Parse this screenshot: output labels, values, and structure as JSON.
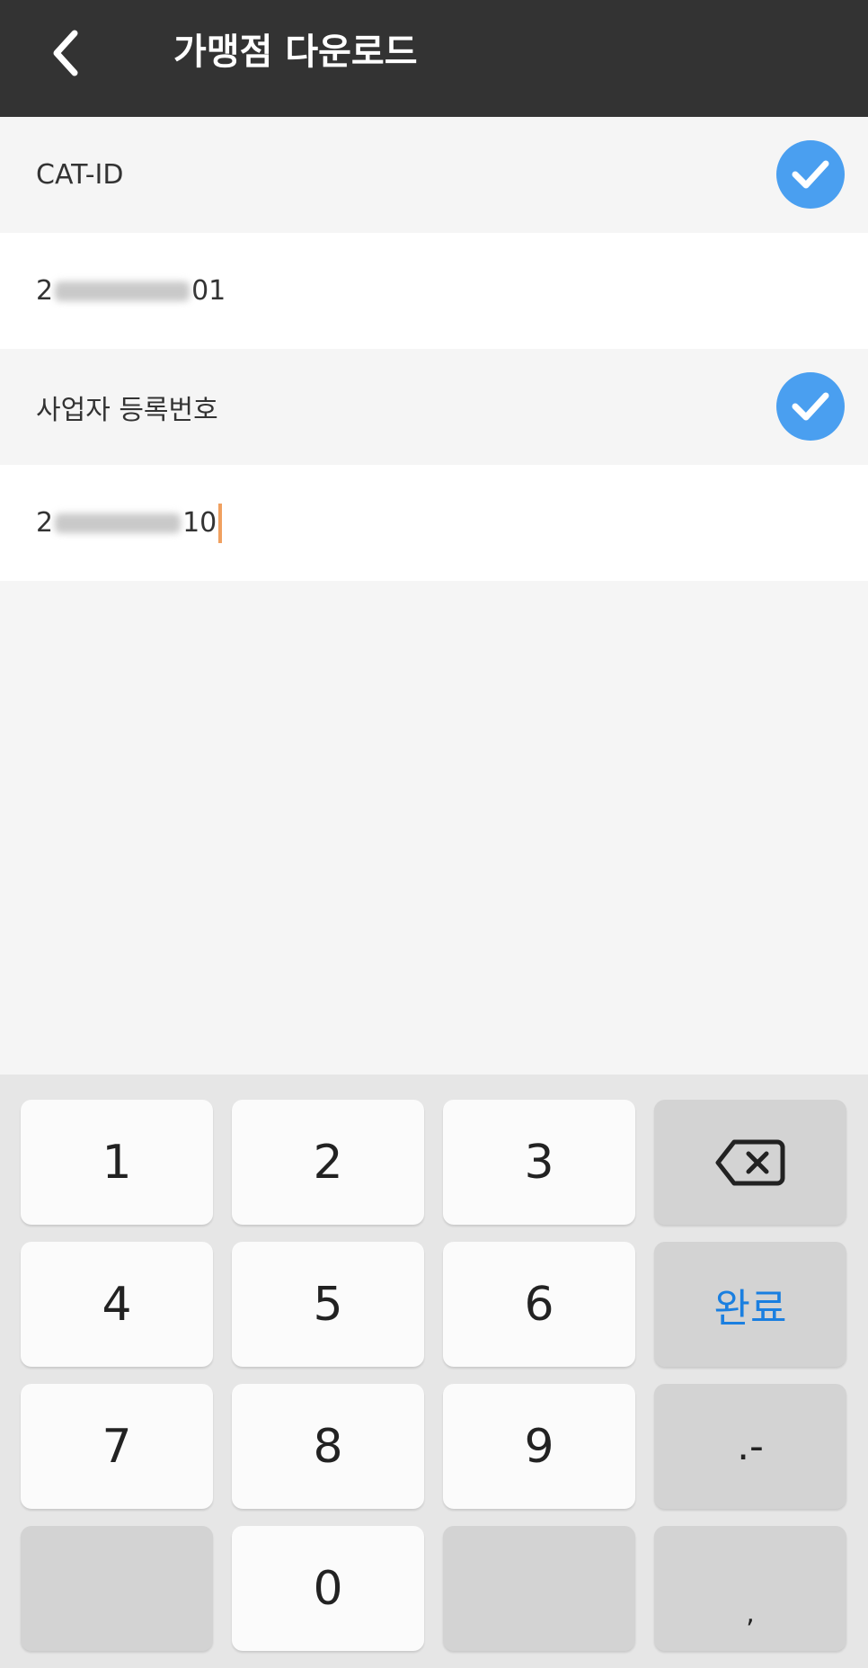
{
  "header": {
    "title": "가맹점 다운로드"
  },
  "fields": [
    {
      "label": "CAT-ID",
      "checked": true,
      "value_start": "2",
      "value_end": "01"
    },
    {
      "label": "사업자 등록번호",
      "checked": true,
      "value_start": "2",
      "value_end": "10"
    }
  ],
  "keyboard": {
    "keys": {
      "k1": "1",
      "k2": "2",
      "k3": "3",
      "k4": "4",
      "k5": "5",
      "k6": "6",
      "k7": "7",
      "k8": "8",
      "k9": "9",
      "k0": "0",
      "done": "완료",
      "symbols": ".-",
      "comma": ","
    }
  },
  "colors": {
    "header_bg": "#333333",
    "check_bg": "#4a9ff0",
    "done_text": "#1a7fe0",
    "cursor": "#f0a060"
  }
}
